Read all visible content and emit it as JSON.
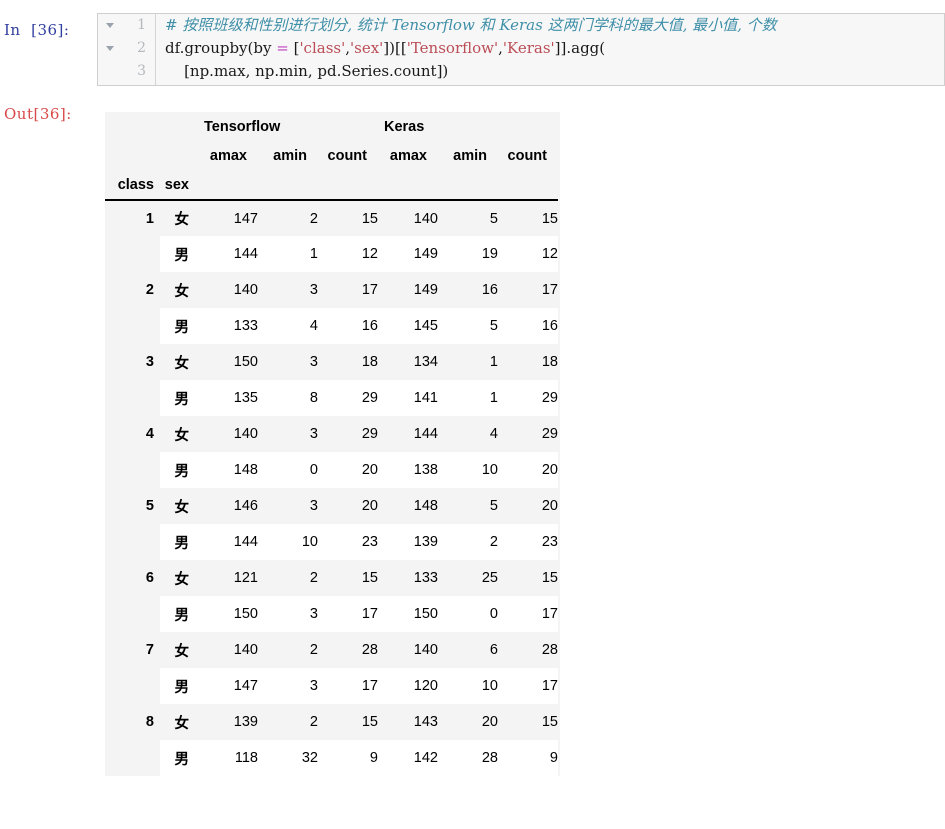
{
  "notebook": {
    "input_prompt": "In  [36]:",
    "output_prompt": "Out[36]:"
  },
  "code_cell": {
    "line_numbers": [
      "1",
      "2",
      "3"
    ],
    "lines": [
      {
        "n": "1",
        "foldable": true,
        "tokens": [
          {
            "type": "comment",
            "text": "# 按照班级和性别进行划分, 统计 Tensorflow 和 Keras 这两门学科的最大值, 最小值, 个数"
          }
        ]
      },
      {
        "n": "2",
        "foldable": true,
        "tokens": [
          {
            "type": "plain",
            "text": "df.groupby(by "
          },
          {
            "type": "op",
            "text": "="
          },
          {
            "type": "plain",
            "text": " ["
          },
          {
            "type": "str",
            "text": "'class'"
          },
          {
            "type": "plain",
            "text": ","
          },
          {
            "type": "str",
            "text": "'sex'"
          },
          {
            "type": "plain",
            "text": "])[["
          },
          {
            "type": "str",
            "text": "'Tensorflow'"
          },
          {
            "type": "plain",
            "text": ","
          },
          {
            "type": "str",
            "text": "'Keras'"
          },
          {
            "type": "plain",
            "text": "]].agg("
          }
        ]
      },
      {
        "n": "3",
        "foldable": false,
        "tokens": [
          {
            "type": "plain",
            "text": "    [np.max, np.min, pd.Series.count])"
          }
        ]
      }
    ]
  },
  "dataframe": {
    "column_groups": [
      {
        "label": "Tensorflow",
        "span": 3
      },
      {
        "label": "Keras",
        "span": 3
      }
    ],
    "sub_columns": [
      "amax",
      "amin",
      "count",
      "amax",
      "amin",
      "count"
    ],
    "index_names": [
      "class",
      "sex"
    ],
    "rows": [
      {
        "class": "1",
        "sex": "女",
        "values": [
          "147",
          "2",
          "15",
          "140",
          "5",
          "15"
        ]
      },
      {
        "class": "",
        "sex": "男",
        "values": [
          "144",
          "1",
          "12",
          "149",
          "19",
          "12"
        ]
      },
      {
        "class": "2",
        "sex": "女",
        "values": [
          "140",
          "3",
          "17",
          "149",
          "16",
          "17"
        ]
      },
      {
        "class": "",
        "sex": "男",
        "values": [
          "133",
          "4",
          "16",
          "145",
          "5",
          "16"
        ]
      },
      {
        "class": "3",
        "sex": "女",
        "values": [
          "150",
          "3",
          "18",
          "134",
          "1",
          "18"
        ]
      },
      {
        "class": "",
        "sex": "男",
        "values": [
          "135",
          "8",
          "29",
          "141",
          "1",
          "29"
        ]
      },
      {
        "class": "4",
        "sex": "女",
        "values": [
          "140",
          "3",
          "29",
          "144",
          "4",
          "29"
        ]
      },
      {
        "class": "",
        "sex": "男",
        "values": [
          "148",
          "0",
          "20",
          "138",
          "10",
          "20"
        ]
      },
      {
        "class": "5",
        "sex": "女",
        "values": [
          "146",
          "3",
          "20",
          "148",
          "5",
          "20"
        ]
      },
      {
        "class": "",
        "sex": "男",
        "values": [
          "144",
          "10",
          "23",
          "139",
          "2",
          "23"
        ]
      },
      {
        "class": "6",
        "sex": "女",
        "values": [
          "121",
          "2",
          "15",
          "133",
          "25",
          "15"
        ]
      },
      {
        "class": "",
        "sex": "男",
        "values": [
          "150",
          "3",
          "17",
          "150",
          "0",
          "17"
        ]
      },
      {
        "class": "7",
        "sex": "女",
        "values": [
          "140",
          "2",
          "28",
          "140",
          "6",
          "28"
        ]
      },
      {
        "class": "",
        "sex": "男",
        "values": [
          "147",
          "3",
          "17",
          "120",
          "10",
          "17"
        ]
      },
      {
        "class": "8",
        "sex": "女",
        "values": [
          "139",
          "2",
          "15",
          "143",
          "20",
          "15"
        ]
      },
      {
        "class": "",
        "sex": "男",
        "values": [
          "118",
          "32",
          "9",
          "142",
          "28",
          "9"
        ]
      }
    ]
  },
  "colors": {
    "in_prompt": "#303f9f",
    "out_prompt": "#d84a49",
    "comment": "#3f8fa8",
    "string": "#bb4d57",
    "operator": "#c040c0",
    "row_stripe": "#f4f4f4",
    "cell_bg": "#f7f7f7"
  }
}
